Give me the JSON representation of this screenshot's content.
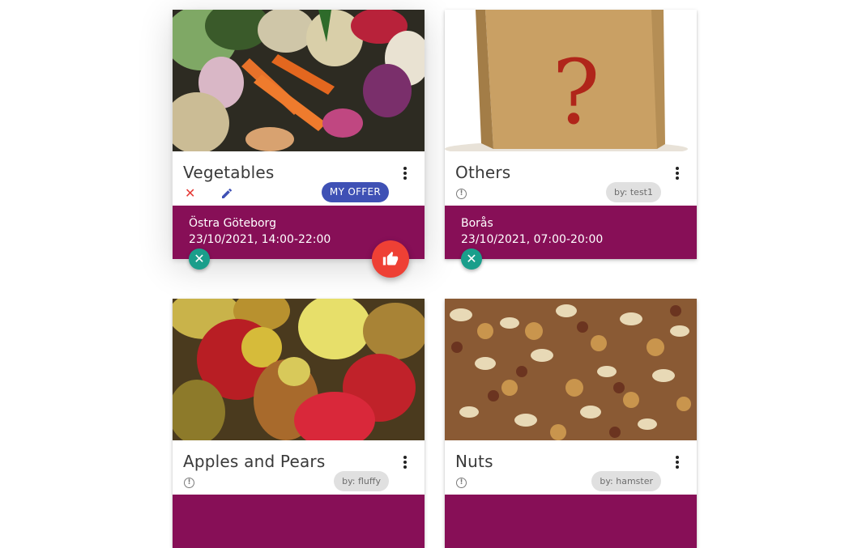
{
  "cards": [
    {
      "title": "Vegetables",
      "chip": "MY OFFER",
      "location": "Östra Göteborg",
      "time": "23/10/2021, 14:00-22:00",
      "image": "vegetables-photo",
      "actions": [
        "close-icon",
        "edit-icon",
        "thumb-up-icon"
      ]
    },
    {
      "title": "Others",
      "chip": "by: test1",
      "location": "Borås",
      "time": "23/10/2021, 07:00-20:00",
      "image": "question-box-photo"
    },
    {
      "title": "Apples and Pears",
      "chip": "by: fluffy",
      "image": "apples-pears-photo"
    },
    {
      "title": "Nuts",
      "chip": "by: hamster",
      "image": "nuts-photo"
    }
  ],
  "colors": {
    "footer": "#870f57",
    "accent_teal": "#1a9e8b",
    "like_red": "#ee4035",
    "offer_blue": "#3f51b5"
  },
  "icons": {
    "cancel": "✕",
    "info": "!"
  }
}
